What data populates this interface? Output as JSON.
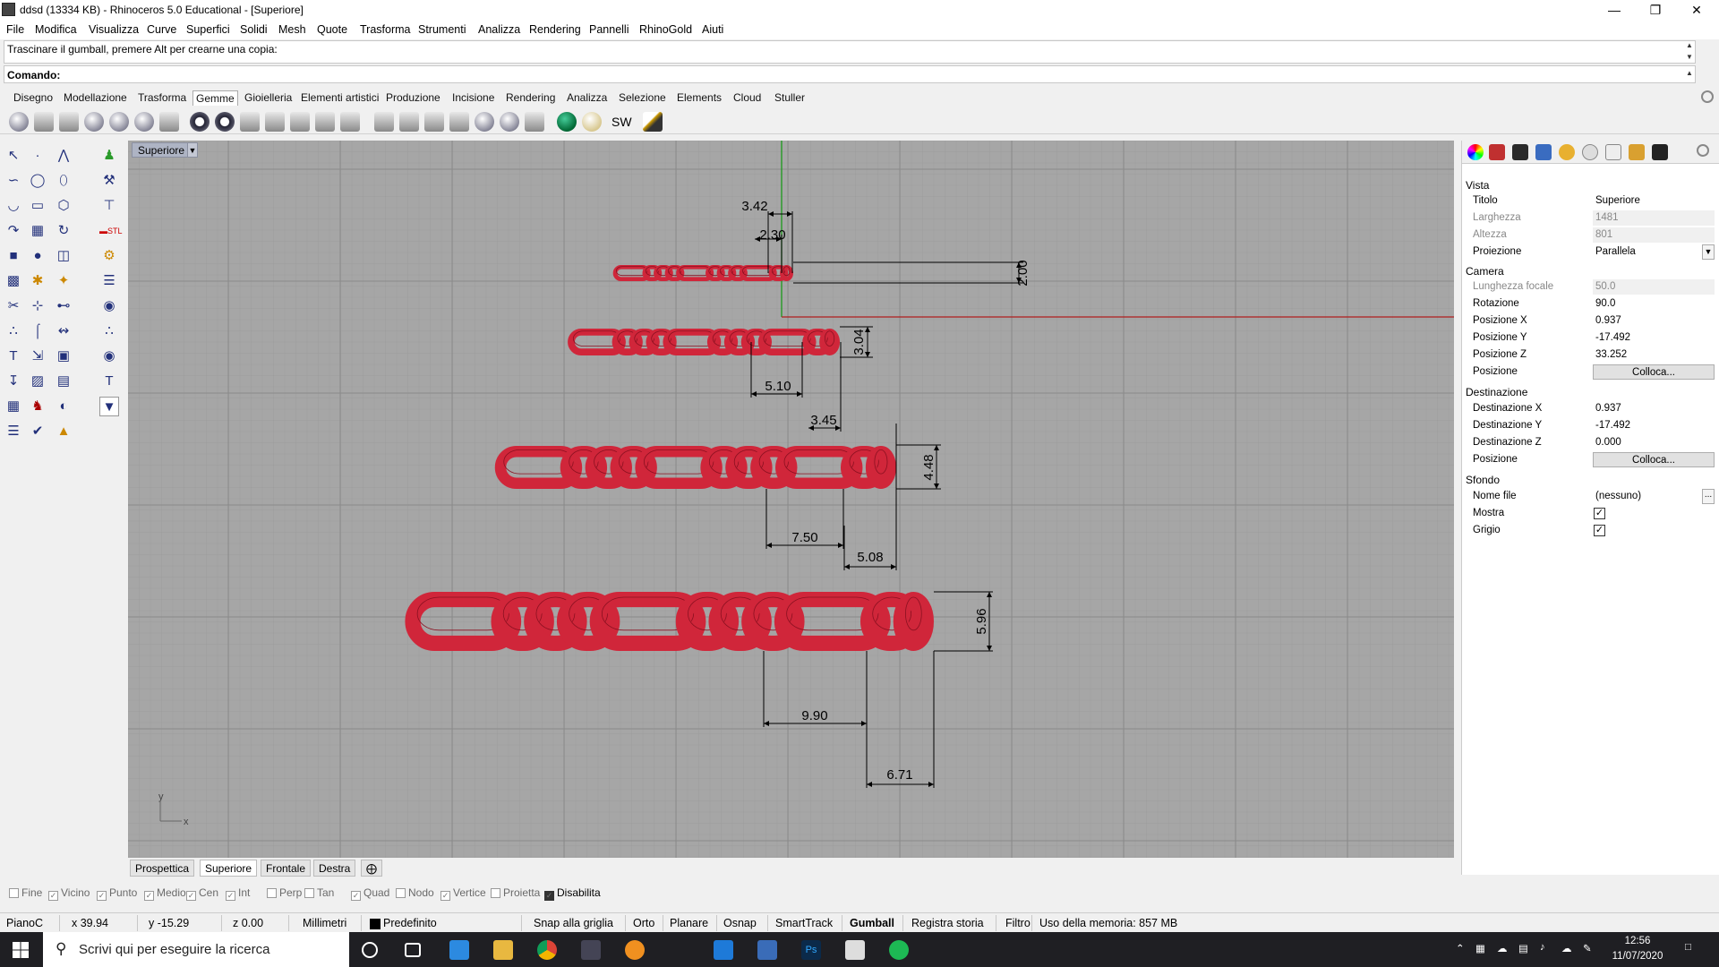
{
  "window": {
    "title": "ddsd (13334 KB) - Rhinoceros 5.0 Educational - [Superiore]"
  },
  "menu": [
    "File",
    "Modifica",
    "Visualizza",
    "Curve",
    "Superfici",
    "Solidi",
    "Mesh",
    "Quote",
    "Trasforma",
    "Strumenti",
    "Analizza",
    "Rendering",
    "Pannelli",
    "RhinoGold",
    "Aiuti"
  ],
  "command": {
    "history": "Trascinare il gumball, premere Alt per crearne una copia:",
    "prompt": "Comando:"
  },
  "toolbar_tabs": [
    "Disegno",
    "Modellazione",
    "Trasforma",
    "Gemme",
    "Gioielleria",
    "Elementi artistici",
    "Produzione",
    "Incisione",
    "Rendering",
    "Analizza",
    "Selezione",
    "Elements",
    "Cloud",
    "Stuller"
  ],
  "toolbar_active_tab": "Gemme",
  "toolbar_text_icon": "SW",
  "viewport": {
    "label": "Superiore",
    "axis_x": "x",
    "axis_y": "y",
    "chain_color": "#d0263a",
    "dimensions": [
      "3.42",
      "2.30",
      "2.00",
      "3.04",
      "5.10",
      "3.45",
      "4.48",
      "7.50",
      "5.08",
      "5.96",
      "9.90",
      "6.71"
    ]
  },
  "viewport_tabs": [
    "Prospettica",
    "Superiore",
    "Frontale",
    "Destra"
  ],
  "viewport_active_tab": "Superiore",
  "panel": {
    "sections": {
      "vista": "Vista",
      "camera": "Camera",
      "destinazione": "Destinazione",
      "sfondo": "Sfondo"
    },
    "rows": {
      "titolo": {
        "label": "Titolo",
        "value": "Superiore"
      },
      "larghezza": {
        "label": "Larghezza",
        "value": "1481"
      },
      "altezza": {
        "label": "Altezza",
        "value": "801"
      },
      "proiezione": {
        "label": "Proiezione",
        "value": "Parallela"
      },
      "focale": {
        "label": "Lunghezza focale",
        "value": "50.0"
      },
      "rotazione": {
        "label": "Rotazione",
        "value": "90.0"
      },
      "posx": {
        "label": "Posizione X",
        "value": "0.937"
      },
      "posy": {
        "label": "Posizione Y",
        "value": "-17.492"
      },
      "posz": {
        "label": "Posizione Z",
        "value": "33.252"
      },
      "pos1": {
        "label": "Posizione",
        "value": "Colloca..."
      },
      "destx": {
        "label": "Destinazione X",
        "value": "0.937"
      },
      "desty": {
        "label": "Destinazione Y",
        "value": "-17.492"
      },
      "destz": {
        "label": "Destinazione Z",
        "value": "0.000"
      },
      "pos2": {
        "label": "Posizione",
        "value": "Colloca..."
      },
      "nomefile": {
        "label": "Nome file",
        "value": "(nessuno)"
      },
      "mostra": {
        "label": "Mostra",
        "checked": true
      },
      "grigio": {
        "label": "Grigio",
        "checked": true
      }
    },
    "browse_button": "..."
  },
  "osnap": [
    {
      "label": "Fine",
      "checked": false
    },
    {
      "label": "Vicino",
      "checked": true
    },
    {
      "label": "Punto",
      "checked": true
    },
    {
      "label": "Medio",
      "checked": true
    },
    {
      "label": "Cen",
      "checked": true
    },
    {
      "label": "Int",
      "checked": true
    },
    {
      "label": "Perp",
      "checked": false
    },
    {
      "label": "Tan",
      "checked": false
    },
    {
      "label": "Quad",
      "checked": true
    },
    {
      "label": "Nodo",
      "checked": false
    },
    {
      "label": "Vertice",
      "checked": true
    },
    {
      "label": "Proietta",
      "checked": false
    },
    {
      "label": "Disabilita",
      "checked": true
    }
  ],
  "status": {
    "cplane": "PianoC",
    "x": "x 39.94",
    "y": "y -15.29",
    "z": "z 0.00",
    "units": "Millimetri",
    "layer": "Predefinito",
    "buttons": [
      "Snap alla griglia",
      "Orto",
      "Planare",
      "Osnap",
      "SmartTrack",
      "Gumball",
      "Registra storia",
      "Filtro"
    ],
    "active_button": "Gumball",
    "memory": "Uso della memoria: 857 MB"
  },
  "taskbar": {
    "search_placeholder": "Scrivi qui per eseguire la ricerca",
    "time": "12:56",
    "date": "11/07/2020"
  }
}
